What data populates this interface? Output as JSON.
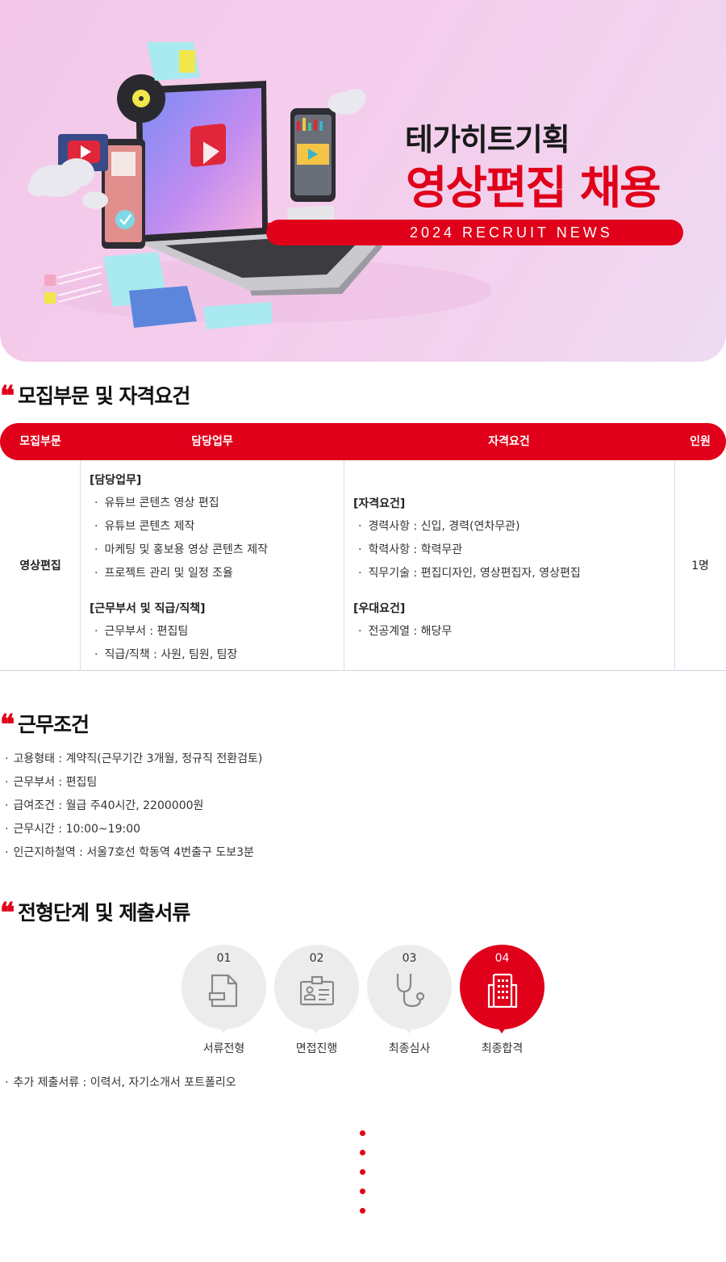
{
  "hero": {
    "company": "테가히트기획",
    "headline": "영상편집 채용",
    "news_bar": "2024 RECRUIT NEWS"
  },
  "section_recruit": {
    "title": "모집부문 및 자격요건",
    "headers": [
      "모집부문",
      "담당업무",
      "자격요건",
      "인원"
    ],
    "position": "영상편집",
    "duties": {
      "title": "[담당업무]",
      "items": [
        "유튜브 콘텐츠 영상 편집",
        "유튜브 콘텐츠 제작",
        "마케팅 및 홍보용 영상 콘텐츠 제작",
        "프로젝트 관리 및 일정 조율"
      ]
    },
    "dept": {
      "title": "[근무부서 및 직급/직책]",
      "items": [
        "근무부서 : 편집팀",
        "직급/직책 : 사원, 팀원, 팀장"
      ]
    },
    "qualifications": {
      "title": "[자격요건]",
      "items": [
        "경력사항 : 신입, 경력(연차무관)",
        "학력사항 : 학력무관",
        "직무기술 : 편집디자인, 영상편집자, 영상편집"
      ]
    },
    "preferred": {
      "title": "[우대요건]",
      "items": [
        "전공계열 : 해당무"
      ]
    },
    "headcount": "1명"
  },
  "section_conditions": {
    "title": "근무조건",
    "items": [
      "고용형태 : 계약직(근무기간 3개월, 정규직 전환검토)",
      "근무부서 : 편집팀",
      "급여조건 : 월급 주40시간, 2200000원",
      "근무시간 : 10:00~19:00",
      "인근지하철역 : 서울7호선 학동역 4번출구 도보3분"
    ]
  },
  "section_process": {
    "title": "전형단계 및 제출서류",
    "steps": [
      {
        "num": "01",
        "label": "서류전형",
        "icon": "document-icon"
      },
      {
        "num": "02",
        "label": "면접진행",
        "icon": "id-card-icon"
      },
      {
        "num": "03",
        "label": "최종심사",
        "icon": "stethoscope-icon"
      },
      {
        "num": "04",
        "label": "최종합격",
        "icon": "building-icon"
      }
    ],
    "active_step": "04",
    "extra": "추가 제출서류 : 이력서, 자기소개서 포트폴리오"
  },
  "colors": {
    "accent": "#e0001a",
    "step_inactive": "#ececec",
    "hero_bg": "#f3c8ea"
  }
}
